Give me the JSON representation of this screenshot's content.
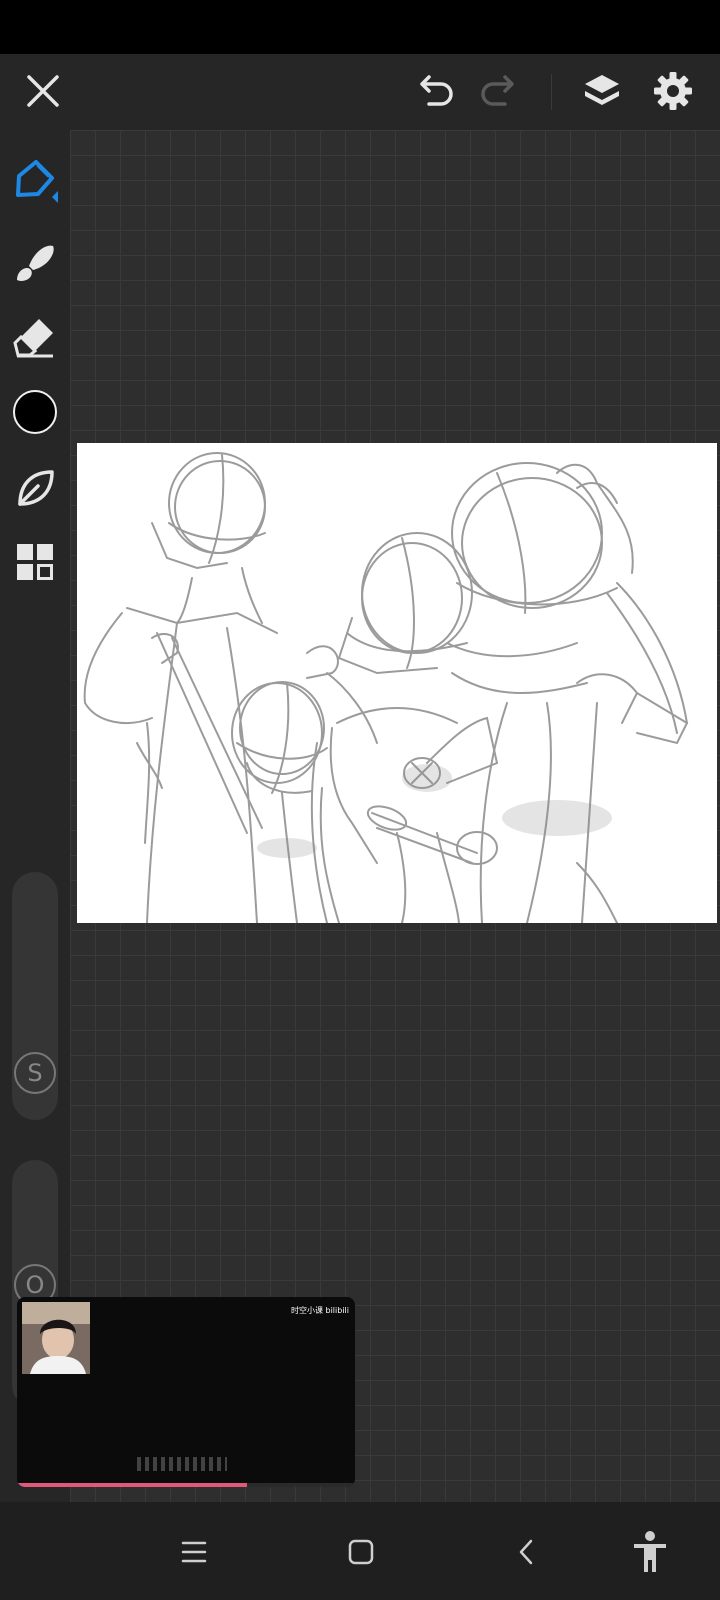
{
  "toolbar": {
    "close_icon": "close-icon",
    "undo_icon": "undo-icon",
    "redo_icon": "redo-icon",
    "layers_icon": "layers-icon",
    "settings_icon": "gear-icon"
  },
  "tools": [
    {
      "name": "pen-tool",
      "icon": "pen-icon",
      "active": true
    },
    {
      "name": "smudge-tool",
      "icon": "brush-icon"
    },
    {
      "name": "eraser-tool",
      "icon": "eraser-icon"
    },
    {
      "name": "color-swatch",
      "color": "#000000"
    },
    {
      "name": "brush-library",
      "icon": "leaf-icon"
    },
    {
      "name": "gallery",
      "icon": "grid-icon"
    }
  ],
  "sliders": {
    "size_label": "S",
    "opacity_label": "O"
  },
  "pip": {
    "brand_text": "时空小课 bilibili",
    "progress": 0.68
  },
  "colors": {
    "accent": "#1e88e5",
    "background": "#1f1f1f",
    "canvas": "#2e2e2e",
    "progress": "#e0597a"
  },
  "navigation": {
    "recents_icon": "menu-icon",
    "home_icon": "home-icon",
    "back_icon": "back-icon",
    "accessibility_icon": "accessibility-icon"
  }
}
